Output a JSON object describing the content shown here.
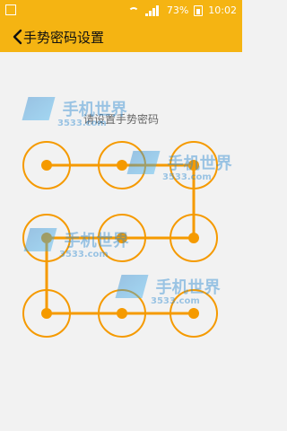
{
  "status": {
    "battery": "73%",
    "time": "10:02"
  },
  "header": {
    "title": "手势密码设置"
  },
  "prompt": "请设置手势密码",
  "watermark": {
    "cn": "手机世界",
    "en": "3533.com"
  },
  "colors": {
    "accent": "#f5b412",
    "pattern": "#f59a00",
    "background": "#f2f2f2"
  }
}
